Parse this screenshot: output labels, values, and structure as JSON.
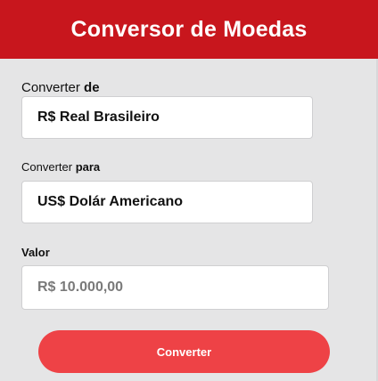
{
  "header": {
    "title": "Conversor de Moedas"
  },
  "form": {
    "from": {
      "label_prefix": "Converter",
      "label_strong": "de",
      "value": "R$ Real Brasileiro"
    },
    "to": {
      "label_prefix": "Converter",
      "label_strong": "para",
      "value": "US$ Dolár Americano"
    },
    "amount": {
      "label": "Valor",
      "placeholder": "R$ 10.000,00"
    },
    "submit_label": "Converter"
  },
  "colors": {
    "header": "#c8161d",
    "button": "#ee4246",
    "background": "#e5e5e6"
  }
}
